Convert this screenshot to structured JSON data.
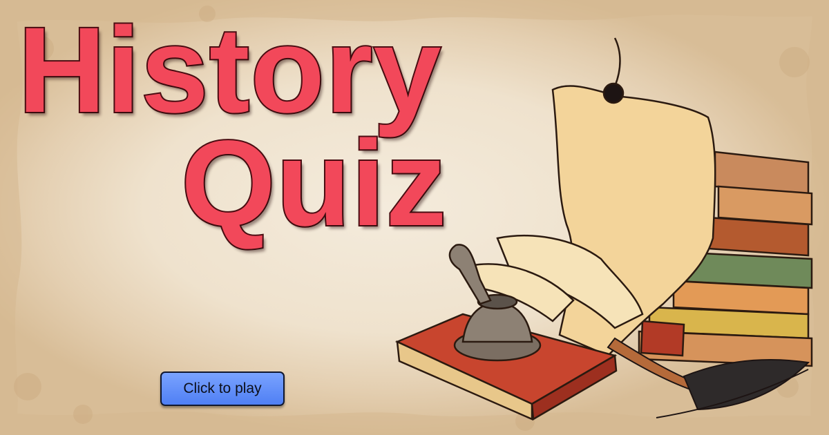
{
  "title": {
    "line1": "History",
    "line2": "Quiz"
  },
  "play_button": {
    "label": "Click to play"
  },
  "colors": {
    "title_fill": "#f2485a",
    "title_outline": "#4a0d12",
    "button_fill": "#5f8cf8",
    "parchment": "#f1e6d4"
  },
  "illustration": {
    "icons": [
      "scroll-icon",
      "book-stack-icon",
      "inkwell-icon",
      "quill-icon",
      "red-book-icon",
      "wax-seal-icon"
    ]
  }
}
